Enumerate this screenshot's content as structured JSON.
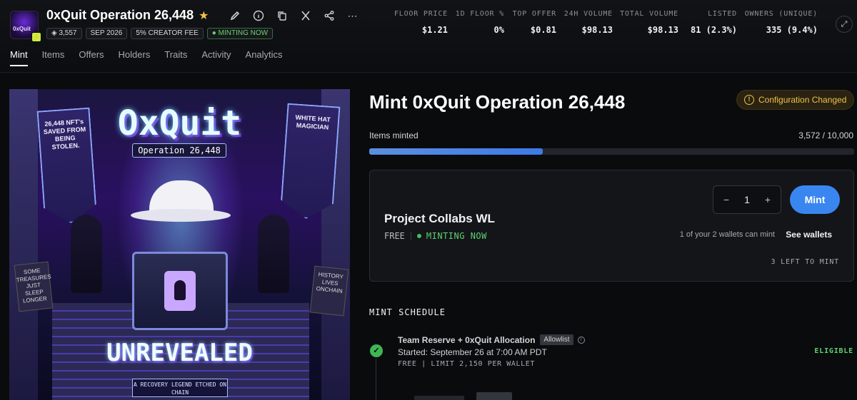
{
  "collection": {
    "title": "0xQuit Operation 26,448",
    "logo_text": "0xQuit",
    "chips": {
      "items_count": "3,557",
      "date": "SEP 2026",
      "creator_fee": "5% CREATOR FEE",
      "status": "MINTING NOW"
    }
  },
  "stats": [
    {
      "label": "FLOOR PRICE",
      "value": "$1.21"
    },
    {
      "label": "1D FLOOR %",
      "value": "0%"
    },
    {
      "label": "TOP OFFER",
      "value": "$0.81"
    },
    {
      "label": "24H VOLUME",
      "value": "$98.13"
    },
    {
      "label": "TOTAL VOLUME",
      "value": "$98.13"
    },
    {
      "label": "LISTED",
      "value": "81 (2.3%)"
    },
    {
      "label": "OWNERS (UNIQUE)",
      "value": "335 (9.4%)"
    }
  ],
  "tabs": [
    "Mint",
    "Items",
    "Offers",
    "Holders",
    "Traits",
    "Activity",
    "Analytics"
  ],
  "artwork": {
    "logo": "OxQuit",
    "subtitle": "Operation 26,448",
    "banner_left": "26,448 NFT's SAVED FROM BEING STOLEN.",
    "banner_right": "WHITE HAT MAGICIAN",
    "sign_left": "SOME TREASURES JUST SLEEP LONGER",
    "sign_right": "HISTORY LIVES ONCHAIN",
    "unrevealed": "UNREVEALED",
    "legend": "A RECOVERY LEGEND ETCHED ON CHAIN"
  },
  "mint": {
    "title": "Mint 0xQuit Operation 26,448",
    "config_badge": "Configuration Changed",
    "items_minted_label": "Items minted",
    "items_minted_value": "3,572 / 10,000",
    "progress": 0.3572,
    "quantity": "1",
    "mint_button": "Mint",
    "phase": {
      "name": "Project Collabs WL",
      "price": "FREE",
      "status": "MINTING NOW",
      "wallet_note": "1 of your 2 wallets can mint",
      "see_wallets": "See wallets",
      "left_to_mint": "3 LEFT TO MINT"
    }
  },
  "schedule": {
    "title": "MINT SCHEDULE",
    "entries": [
      {
        "name": "Team Reserve + 0xQuit Allocation",
        "badge": "Allowlist",
        "start": "Started: September 26 at 7:00 AM PDT",
        "limit": "FREE | LIMIT 2,150 PER WALLET",
        "status": "ELIGIBLE"
      }
    ]
  },
  "colors": {
    "accent": "#3a86f0",
    "success": "#5fd073",
    "warning": "#f0c14b",
    "background": "#0a0b0d"
  }
}
